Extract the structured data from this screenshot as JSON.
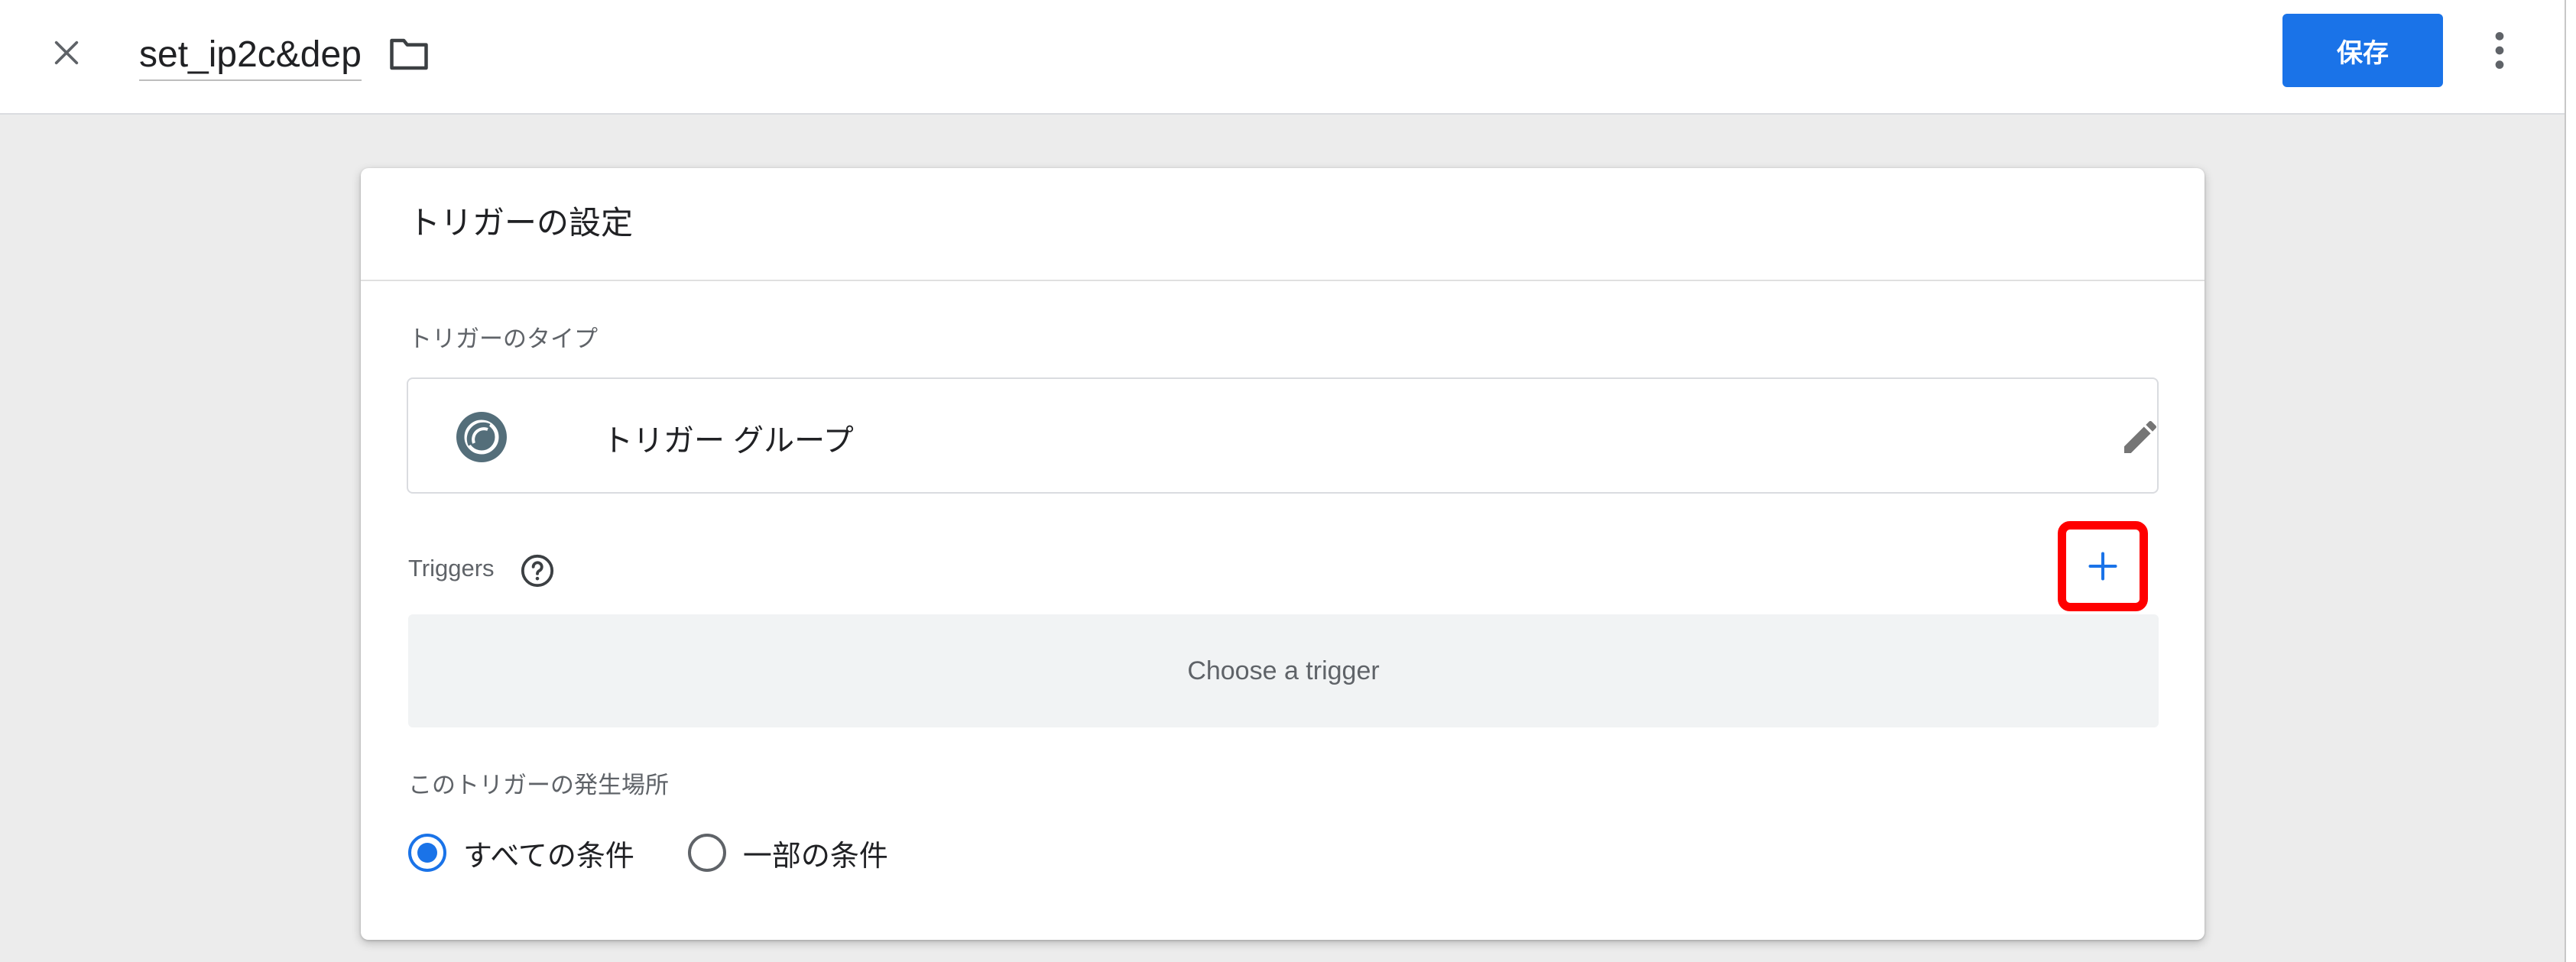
{
  "header": {
    "title": "set_ip2c&dep",
    "save_label": "保存",
    "close_icon": "close-icon",
    "folder_icon": "folder-icon",
    "more_icon": "more-vert-icon"
  },
  "card": {
    "title": "トリガーの設定",
    "trigger_type_label": "トリガーのタイプ",
    "trigger_type_name": "トリガー グループ",
    "triggers_label": "Triggers",
    "choose_trigger_placeholder": "Choose a trigger",
    "fire_on_label": "このトリガーの発生場所",
    "fire_on_options": [
      {
        "label": "すべての条件",
        "checked": true
      },
      {
        "label": "一部の条件",
        "checked": false
      }
    ]
  },
  "colors": {
    "accent": "#1a73e8",
    "highlight_border": "#ff0000",
    "background": "#ececec"
  }
}
